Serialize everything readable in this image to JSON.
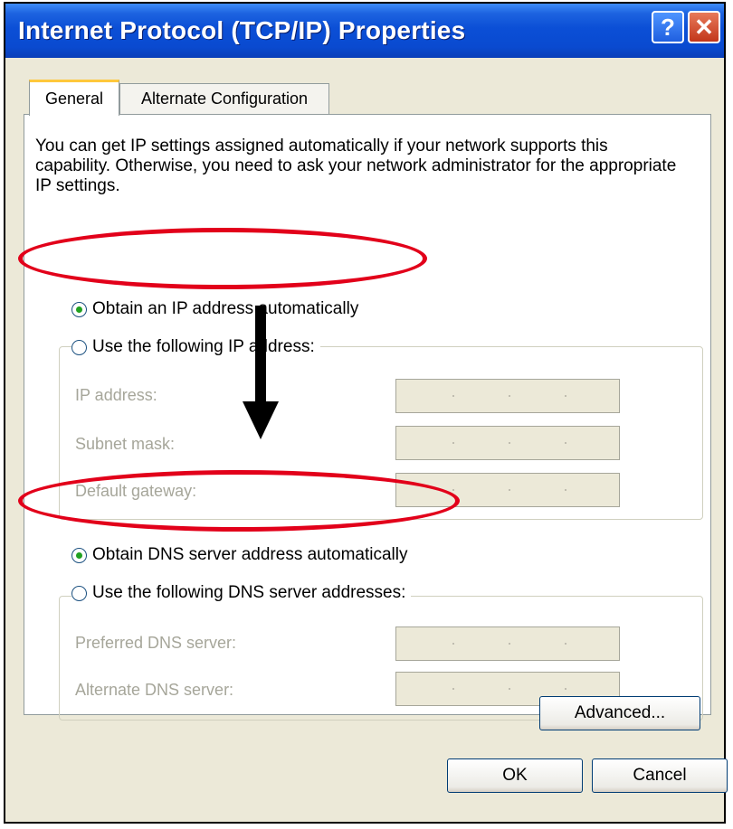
{
  "window": {
    "title": "Internet Protocol (TCP/IP) Properties",
    "help_label": "?",
    "close_label": "✕"
  },
  "tabs": [
    "General",
    "Alternate Configuration"
  ],
  "intro_text": "You can get IP settings assigned automatically if your network supports this capability. Otherwise, you need to ask your network administrator for the appropriate IP settings.",
  "ip_section": {
    "auto_label": "Obtain an IP address automatically",
    "auto_selected": true,
    "manual_label": "Use the following IP address:",
    "fields": [
      {
        "label": "IP address:",
        "value": ""
      },
      {
        "label": "Subnet mask:",
        "value": ""
      },
      {
        "label": "Default gateway:",
        "value": ""
      }
    ]
  },
  "dns_section": {
    "auto_label": "Obtain DNS server address automatically",
    "auto_selected": true,
    "manual_label": "Use the following DNS server addresses:",
    "fields": [
      {
        "label": "Preferred DNS server:",
        "value": ""
      },
      {
        "label": "Alternate DNS server:",
        "value": ""
      }
    ]
  },
  "buttons": {
    "advanced": "Advanced...",
    "ok": "OK",
    "cancel": "Cancel"
  },
  "annotation_color": "#e2001a",
  "radio_selected_color": "#21a121"
}
